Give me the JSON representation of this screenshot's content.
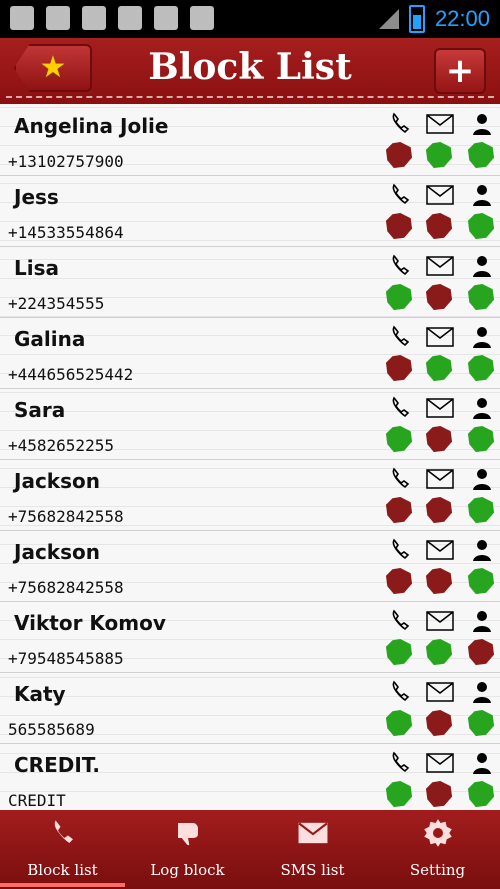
{
  "statusbar": {
    "time": "22:00"
  },
  "header": {
    "title": "Block List"
  },
  "list": {
    "items": [
      {
        "name": "Angelina Jolie",
        "phone": "+13102757900",
        "status": [
          "red",
          "green",
          "green"
        ]
      },
      {
        "name": "Jess",
        "phone": "+14533554864",
        "status": [
          "red",
          "red",
          "green"
        ]
      },
      {
        "name": "Lisa",
        "phone": "+224354555",
        "status": [
          "green",
          "red",
          "green"
        ]
      },
      {
        "name": "Galina",
        "phone": "+444656525442",
        "status": [
          "red",
          "green",
          "green"
        ]
      },
      {
        "name": "Sara",
        "phone": "+4582652255",
        "status": [
          "green",
          "red",
          "green"
        ]
      },
      {
        "name": "Jackson",
        "phone": "+75682842558",
        "status": [
          "red",
          "red",
          "green"
        ]
      },
      {
        "name": "Jackson",
        "phone": "+75682842558",
        "status": [
          "red",
          "red",
          "green"
        ]
      },
      {
        "name": "Viktor Komov",
        "phone": "+79548545885",
        "status": [
          "green",
          "green",
          "red"
        ]
      },
      {
        "name": "Katy",
        "phone": "565585689",
        "status": [
          "green",
          "red",
          "green"
        ]
      },
      {
        "name": "CREDIT.",
        "phone": "CREDIT",
        "status": [
          "green",
          "red",
          "green"
        ]
      }
    ]
  },
  "bottom_nav": {
    "tabs": [
      {
        "label": "Block list"
      },
      {
        "label": "Log block"
      },
      {
        "label": "SMS list"
      },
      {
        "label": "Setting"
      }
    ]
  },
  "colors": {
    "status_green": "#27a51f",
    "status_red": "#8b1a1a",
    "accent_red": "#9b1515"
  }
}
